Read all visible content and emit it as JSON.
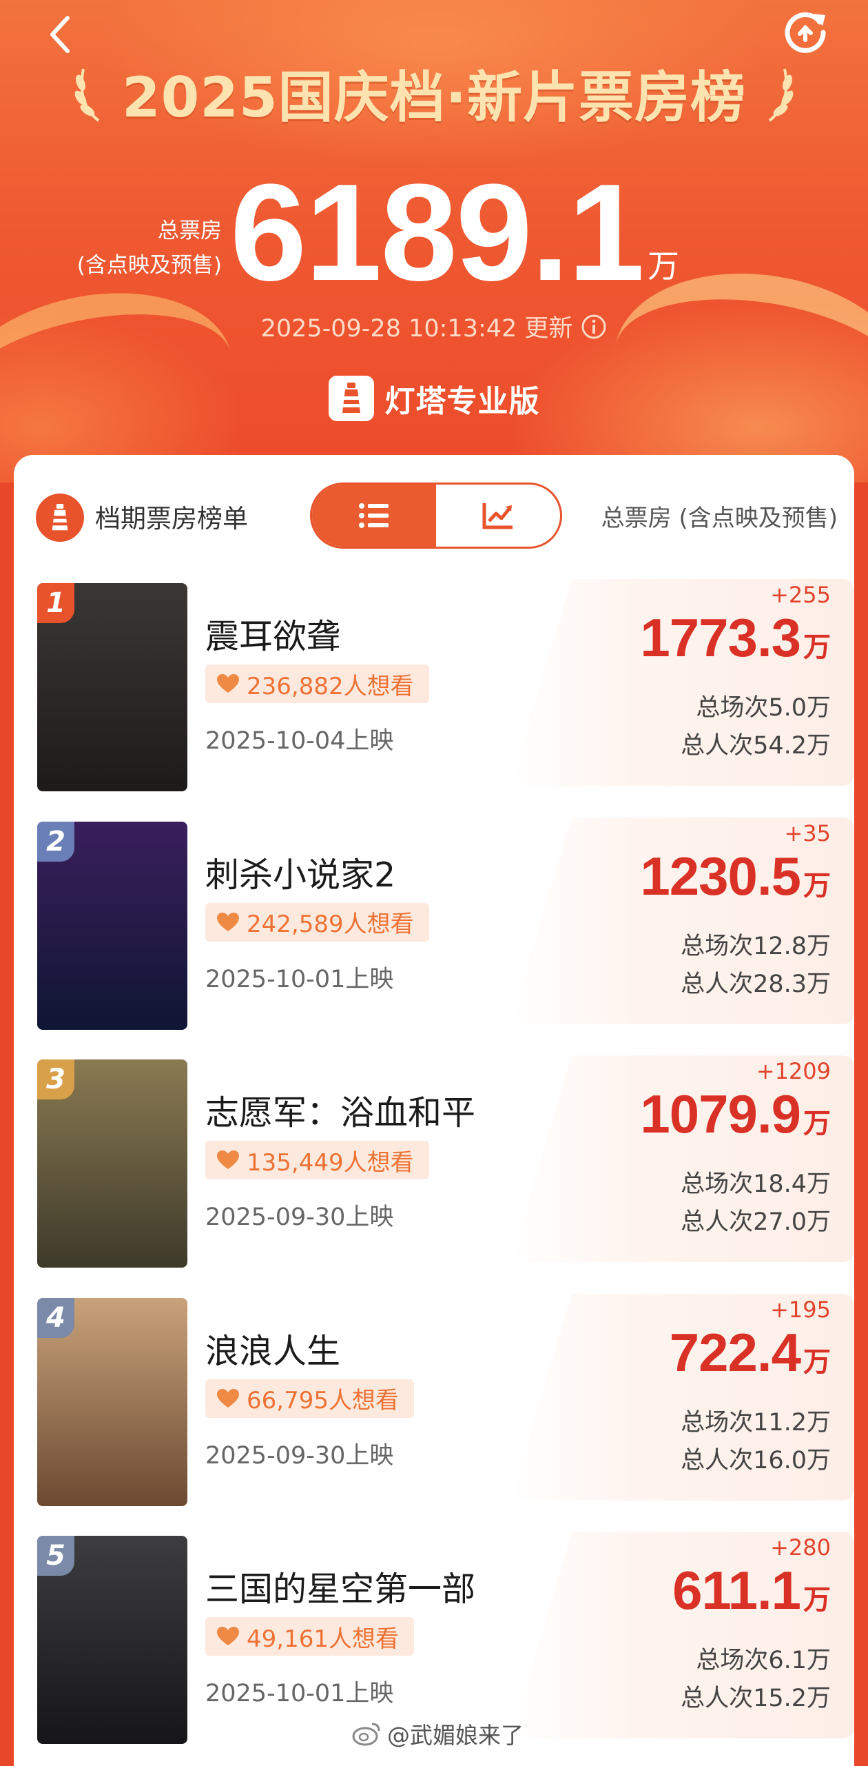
{
  "header": {
    "title": "2025国庆档·新片票房榜",
    "total_label_line1": "总票房",
    "total_label_line2": "(含点映及预售)",
    "total_value": "6189.1",
    "total_unit": "万",
    "updated": "2025-09-28 10:13:42 更新",
    "brand": "灯塔专业版"
  },
  "list_header": {
    "title": "档期票房榜单",
    "metric_label": "总票房 (含点映及预售)",
    "view_tabs": [
      "list-icon",
      "trend-chart-icon"
    ],
    "active_tab": "list-icon"
  },
  "movies": [
    {
      "rank": "1",
      "name": "震耳欲聋",
      "want": "236,882人想看",
      "release": "2025-10-04上映",
      "delta": "+255",
      "box": "1773.3",
      "unit": "万",
      "shows": "总场次5.0万",
      "people": "总人次54.2万",
      "poster_colors": [
        "#3a3735",
        "#1d1b1a"
      ],
      "badge_color": "#e8532c"
    },
    {
      "rank": "2",
      "name": "刺杀小说家2",
      "want": "242,589人想看",
      "release": "2025-10-01上映",
      "delta": "+35",
      "box": "1230.5",
      "unit": "万",
      "shows": "总场次12.8万",
      "people": "总人次28.3万",
      "poster_colors": [
        "#3a1f5c",
        "#0f1633"
      ],
      "badge_color": "#6a7fb8"
    },
    {
      "rank": "3",
      "name": "志愿军：浴血和平",
      "want": "135,449人想看",
      "release": "2025-09-30上映",
      "delta": "+1209",
      "box": "1079.9",
      "unit": "万",
      "shows": "总场次18.4万",
      "people": "总人次27.0万",
      "poster_colors": [
        "#8a7a52",
        "#3e3a2a"
      ],
      "badge_color": "#d9a04a"
    },
    {
      "rank": "4",
      "name": "浪浪人生",
      "want": "66,795人想看",
      "release": "2025-09-30上映",
      "delta": "+195",
      "box": "722.4",
      "unit": "万",
      "shows": "总场次11.2万",
      "people": "总人次16.0万",
      "poster_colors": [
        "#c9a27a",
        "#6b4a32"
      ],
      "badge_color": "#7a8aa8"
    },
    {
      "rank": "5",
      "name": "三国的星空第一部",
      "want": "49,161人想看",
      "release": "2025-10-01上映",
      "delta": "+280",
      "box": "611.1",
      "unit": "万",
      "shows": "总场次6.1万",
      "people": "总人次15.2万",
      "poster_colors": [
        "#3d3d3f",
        "#161618"
      ],
      "badge_color": "#7a8aa8"
    }
  ],
  "watermark": "@武媚娘来了",
  "colors": {
    "accent": "#e8532c",
    "value_red": "#d93126",
    "want_orange": "#ee7234"
  }
}
